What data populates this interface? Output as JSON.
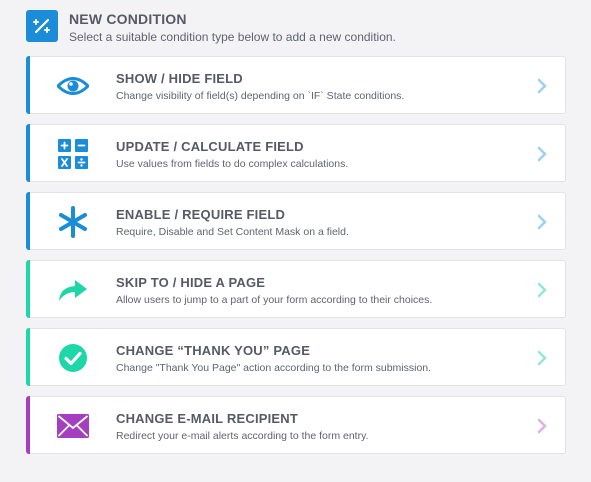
{
  "header": {
    "icon": "wand-icon",
    "title": "NEW CONDITION",
    "subtitle": "Select a suitable condition type below to add a new condition."
  },
  "conditions": [
    {
      "title": "SHOW / HIDE FIELD",
      "description": "Change visibility of field(s) depending on `IF` State conditions.",
      "icon": "eye-icon",
      "color": "#1a8cd8",
      "chevron_color": "#9cd3ee"
    },
    {
      "title": "UPDATE / CALCULATE FIELD",
      "description": "Use values from fields to do complex calculations.",
      "icon": "calculator-icon",
      "color": "#1a8cd8",
      "chevron_color": "#9cd3ee"
    },
    {
      "title": "ENABLE / REQUIRE FIELD",
      "description": "Require, Disable and Set Content Mask on a field.",
      "icon": "asterisk-icon",
      "color": "#1a8cd8",
      "chevron_color": "#9cd3ee"
    },
    {
      "title": "SKIP TO / HIDE A PAGE",
      "description": "Allow users to jump to a part of your form according to their choices.",
      "icon": "share-arrow-icon",
      "color": "#1ed7a8",
      "chevron_color": "#92ead6"
    },
    {
      "title": "CHANGE “THANK YOU” PAGE",
      "description": "Change \"Thank You Page\" action according to the form submission.",
      "icon": "check-circle-icon",
      "color": "#1ed7a8",
      "chevron_color": "#92ead6"
    },
    {
      "title": "CHANGE E-MAIL RECIPIENT",
      "description": "Redirect your e-mail alerts according to the form entry.",
      "icon": "envelope-icon",
      "color": "#a53fbf",
      "chevron_color": "#ddb0e6"
    }
  ]
}
